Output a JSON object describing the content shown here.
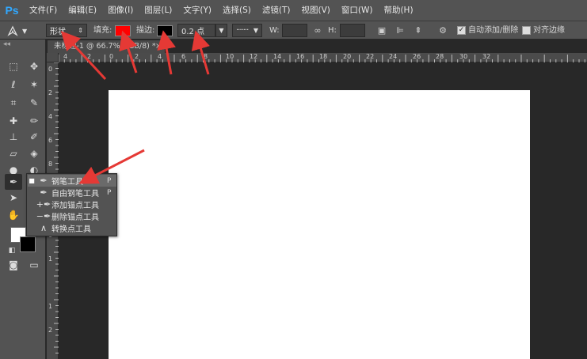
{
  "app": {
    "logo": "Ps"
  },
  "menu": [
    "文件(F)",
    "编辑(E)",
    "图像(I)",
    "图层(L)",
    "文字(Y)",
    "选择(S)",
    "滤镜(T)",
    "视图(V)",
    "窗口(W)",
    "帮助(H)"
  ],
  "options": {
    "mode_value": "形状",
    "fill_label": "填充:",
    "fill_color": "#ff0000",
    "stroke_label": "描边:",
    "stroke_color": "#000000",
    "stroke_width_value": "0.2 点",
    "width_label": "W:",
    "height_label": "H:",
    "auto_add_delete_label": "自动添加/删除",
    "auto_add_delete_checked": true,
    "align_edges_label": "对齐边缘",
    "align_edges_checked": false
  },
  "document": {
    "tab_title": "未标题-1 @ 66.7%(RGB/8) *",
    "close": "×"
  },
  "ruler_top": [
    "4",
    "2",
    "0",
    "2",
    "4",
    "6",
    "8",
    "10",
    "12",
    "14",
    "16",
    "18",
    "20",
    "22",
    "24",
    "26",
    "28",
    "30",
    "32"
  ],
  "ruler_left": [
    "0",
    "2",
    "4",
    "6",
    "8",
    "1",
    "1",
    "1",
    "1",
    "1",
    "2"
  ],
  "colors": {
    "foreground": "#ffffff",
    "background": "#000000",
    "annotation_arrow": "#e53935"
  },
  "flyout": [
    {
      "icon": "pen-icon",
      "label": "钢笔工具",
      "key": "P",
      "selected": true
    },
    {
      "icon": "freeform-pen-icon",
      "label": "自由钢笔工具",
      "key": "P",
      "selected": false
    },
    {
      "icon": "add-anchor-icon",
      "label": "添加锚点工具",
      "key": "",
      "selected": false
    },
    {
      "icon": "delete-anchor-icon",
      "label": "删除锚点工具",
      "key": "",
      "selected": false
    },
    {
      "icon": "convert-point-icon",
      "label": "转换点工具",
      "key": "",
      "selected": false
    }
  ]
}
